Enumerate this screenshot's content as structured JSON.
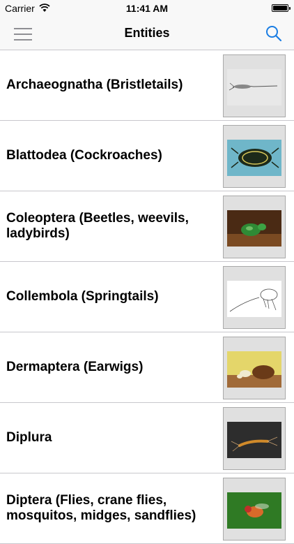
{
  "status_bar": {
    "carrier": "Carrier",
    "time": "11:41 AM"
  },
  "nav": {
    "title": "Entities",
    "menu_icon": "hamburger-menu-icon",
    "search_icon": "search-icon",
    "accent_color": "#1a7de3"
  },
  "entities": [
    {
      "name": "Archaeognatha (Bristletails)",
      "thumbnail": "bristletail-drawing"
    },
    {
      "name": "Blattodea (Cockroaches)",
      "thumbnail": "cockroach-photo"
    },
    {
      "name": "Coleoptera (Beetles, weevils, ladybirds)",
      "thumbnail": "beetle-photo"
    },
    {
      "name": "Collembola (Springtails)",
      "thumbnail": "springtail-drawing"
    },
    {
      "name": "Dermaptera (Earwigs)",
      "thumbnail": "earwig-photo"
    },
    {
      "name": "Diplura",
      "thumbnail": "diplura-photo"
    },
    {
      "name": "Diptera (Flies, crane flies, mosquitos, midges, sandflies)",
      "thumbnail": "fly-photo"
    }
  ]
}
